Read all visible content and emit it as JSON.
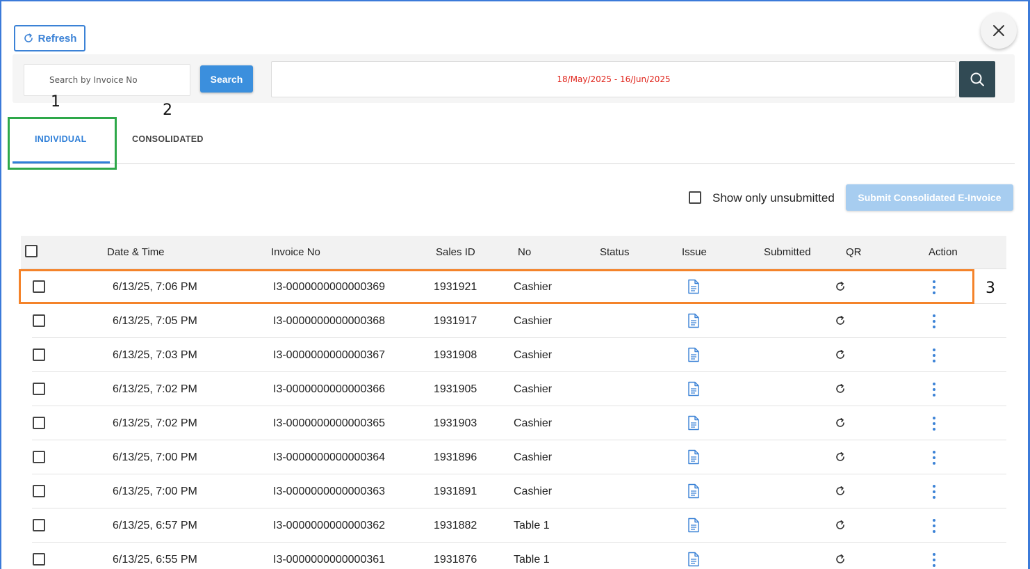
{
  "toolbar": {
    "refresh_label": "Refresh"
  },
  "search": {
    "placeholder": "Search by Invoice No",
    "button_label": "Search"
  },
  "date_range": "18/May/2025 - 16/Jun/2025",
  "annotations": [
    "1",
    "2",
    "3"
  ],
  "tabs": [
    {
      "label": "INDIVIDUAL",
      "active": true
    },
    {
      "label": "CONSOLIDATED",
      "active": false
    }
  ],
  "filters": {
    "show_unsubmitted_label": "Show only unsubmitted",
    "submit_consolidated_label": "Submit Consolidated E-Invoice"
  },
  "table": {
    "columns": [
      "Date & Time",
      "Invoice No",
      "Sales ID",
      "No",
      "Status",
      "Issue",
      "Submitted",
      "QR",
      "Action"
    ],
    "rows": [
      {
        "datetime": "6/13/25, 7:06 PM",
        "invoice": "I3-0000000000000369",
        "sales_id": "1931921",
        "no": "Cashier"
      },
      {
        "datetime": "6/13/25, 7:05 PM",
        "invoice": "I3-0000000000000368",
        "sales_id": "1931917",
        "no": "Cashier"
      },
      {
        "datetime": "6/13/25, 7:03 PM",
        "invoice": "I3-0000000000000367",
        "sales_id": "1931908",
        "no": "Cashier"
      },
      {
        "datetime": "6/13/25, 7:02 PM",
        "invoice": "I3-0000000000000366",
        "sales_id": "1931905",
        "no": "Cashier"
      },
      {
        "datetime": "6/13/25, 7:02 PM",
        "invoice": "I3-0000000000000365",
        "sales_id": "1931903",
        "no": "Cashier"
      },
      {
        "datetime": "6/13/25, 7:00 PM",
        "invoice": "I3-0000000000000364",
        "sales_id": "1931896",
        "no": "Cashier"
      },
      {
        "datetime": "6/13/25, 7:00 PM",
        "invoice": "I3-0000000000000363",
        "sales_id": "1931891",
        "no": "Cashier"
      },
      {
        "datetime": "6/13/25, 6:57 PM",
        "invoice": "I3-0000000000000362",
        "sales_id": "1931882",
        "no": "Table 1"
      },
      {
        "datetime": "6/13/25, 6:55 PM",
        "invoice": "I3-0000000000000361",
        "sales_id": "1931876",
        "no": "Table 1"
      }
    ]
  },
  "icons": {
    "refresh": "refresh-icon",
    "close": "close-icon",
    "search": "search-icon",
    "issue": "document-icon",
    "qr": "reload-icon",
    "action": "more-vertical-icon"
  },
  "colors": {
    "primary": "#3b82d6",
    "date_text": "#e0241b",
    "dark_button": "#314a54",
    "highlight_green": "#2ea84a",
    "highlight_orange": "#f4832a",
    "disabled_button": "#a7cdf0"
  }
}
